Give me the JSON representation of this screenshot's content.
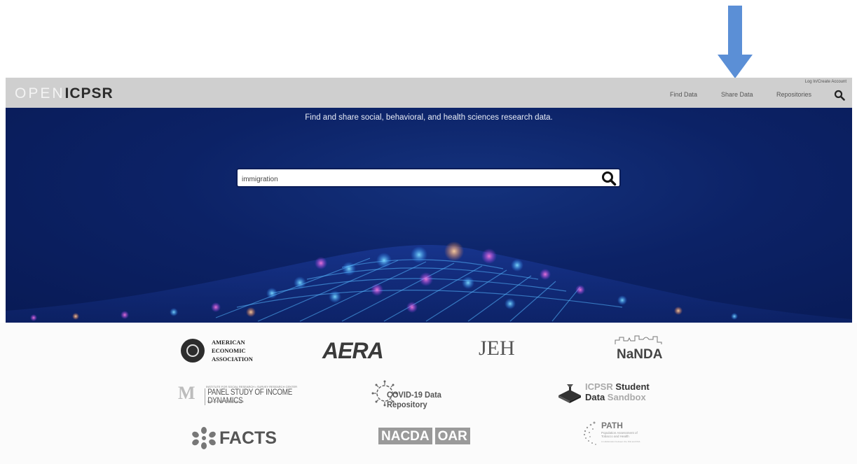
{
  "header": {
    "logo_open": "OPEN",
    "logo_icpsr": "ICPSR",
    "login": "Log In/Create Account",
    "nav": {
      "find_data": "Find Data",
      "share_data": "Share Data",
      "repositories": "Repositories"
    }
  },
  "hero": {
    "tagline": "Find and share social, behavioral, and health sciences research data.",
    "search_value": "immigration"
  },
  "partners": {
    "aea": "AMERICAN ECONOMIC ASSOCIATION",
    "aera": "AERA",
    "jeh": "JEH",
    "nanda": "NaNDA",
    "psid_small": "INSTITUTE FOR SOCIAL RESEARCH • SURVEY RESEARCH CENTER",
    "psid": "PANEL STUDY OF INCOME DYNAMICS",
    "psid_small2": "UNIVERSITY OF MICHIGAN",
    "covid": "COVID-19 Data Repository",
    "sandbox_l1a": "ICPSR",
    "sandbox_l1b": " Student",
    "sandbox_l2a": "Data ",
    "sandbox_l2b": "Sandbox",
    "facts": "FACTS",
    "nacda": "NACDA",
    "oar": "OAR",
    "path": "PATH",
    "path_sub": "Population Assessment of Tobacco and Health",
    "path_note": "A collaboration between the NIH and FDA"
  },
  "colors": {
    "arrow": "#5b8fd6",
    "header_bg": "#cfcfcf",
    "hero_bg": "#0c2266"
  }
}
